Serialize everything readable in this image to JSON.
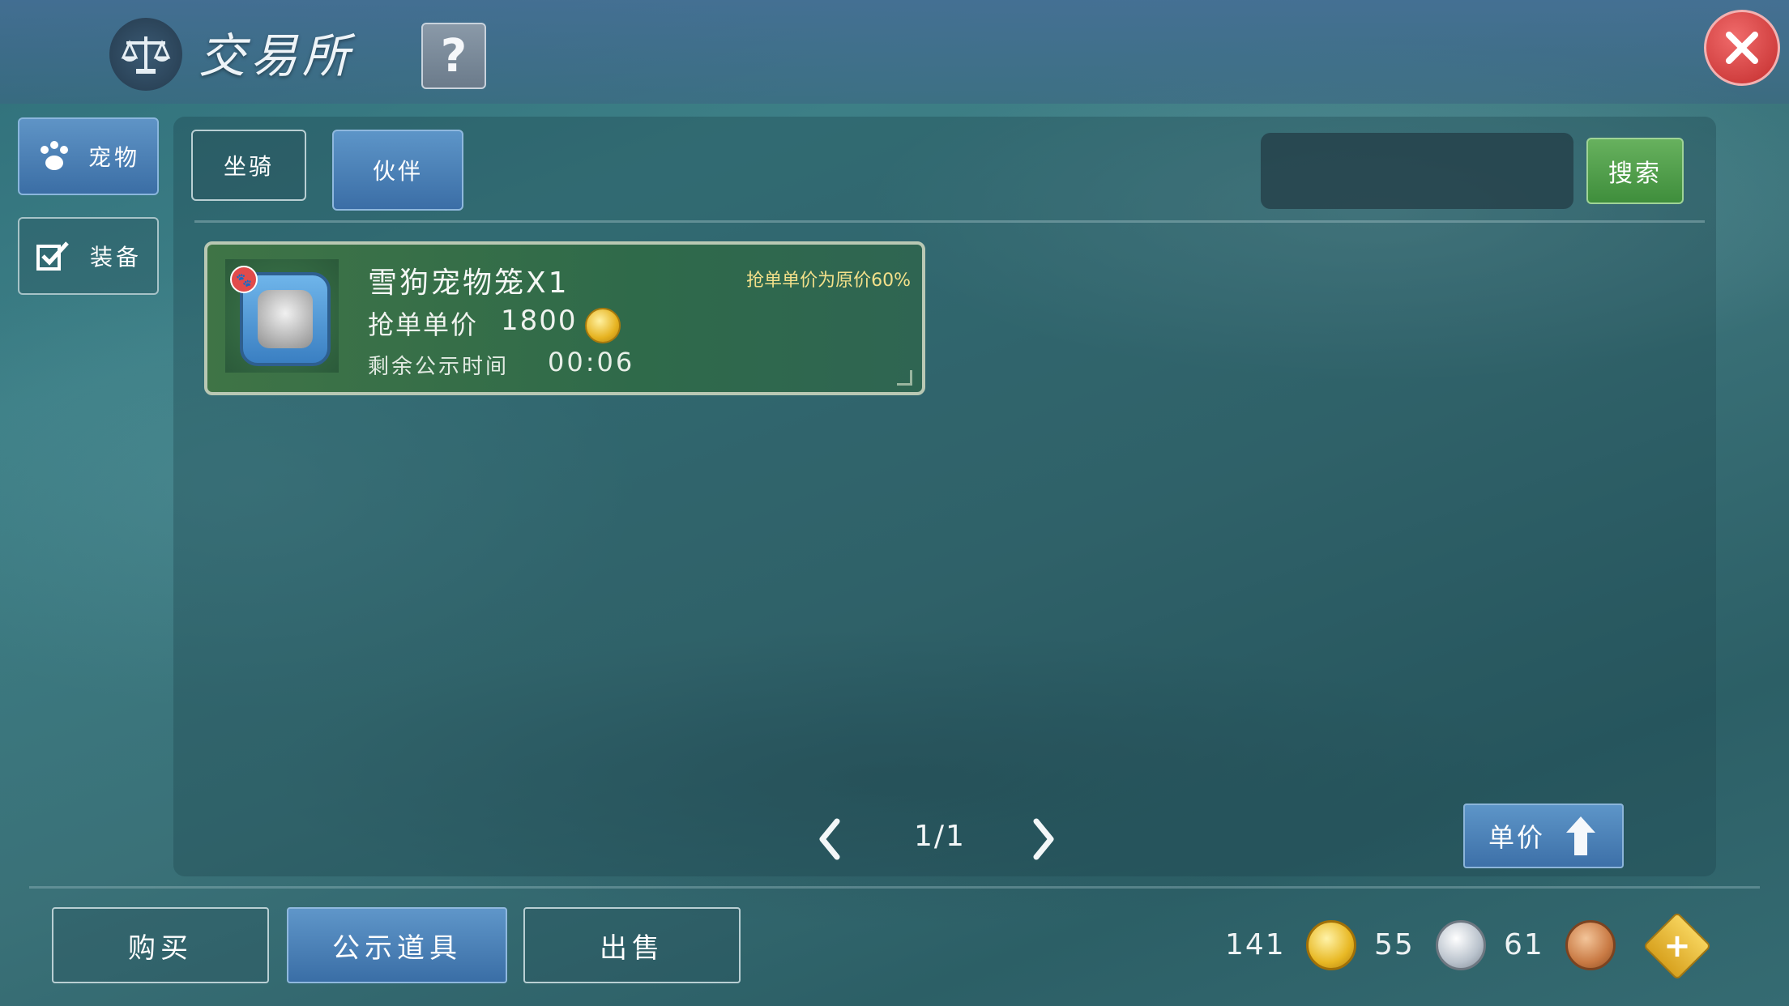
{
  "window": {
    "title": "交易所",
    "help_label": "?",
    "close_label": "✕"
  },
  "sidebar": {
    "items": [
      {
        "label": "宠物"
      },
      {
        "label": "装备"
      }
    ]
  },
  "category_tabs": [
    {
      "label": "坐骑"
    },
    {
      "label": "伙伴"
    }
  ],
  "search": {
    "value": "",
    "placeholder": "",
    "button_label": "搜索"
  },
  "listing": {
    "name": "雪狗宠物笼X1",
    "discount_note": "抢单单价为原价60%",
    "price_label": "抢单单价",
    "price_value": "1800",
    "time_label": "剩余公示时间",
    "time_value": "00:06"
  },
  "pagination": {
    "text": "1/1",
    "prev_icon": "chevron-left-icon",
    "next_icon": "chevron-right-icon"
  },
  "sort_button": {
    "label": "单价",
    "icon": "sort-arrow-icon"
  },
  "bottom_tabs": [
    {
      "label": "购买"
    },
    {
      "label": "公示道具"
    },
    {
      "label": "出售"
    }
  ],
  "currency": {
    "gold": "141",
    "silver": "55",
    "copper": "61"
  },
  "colors": {
    "accent_blue": "#3b6ea5",
    "search_green": "#4a9a45",
    "close_red": "#c32c2c",
    "discount_yellow": "#f3e08a"
  }
}
